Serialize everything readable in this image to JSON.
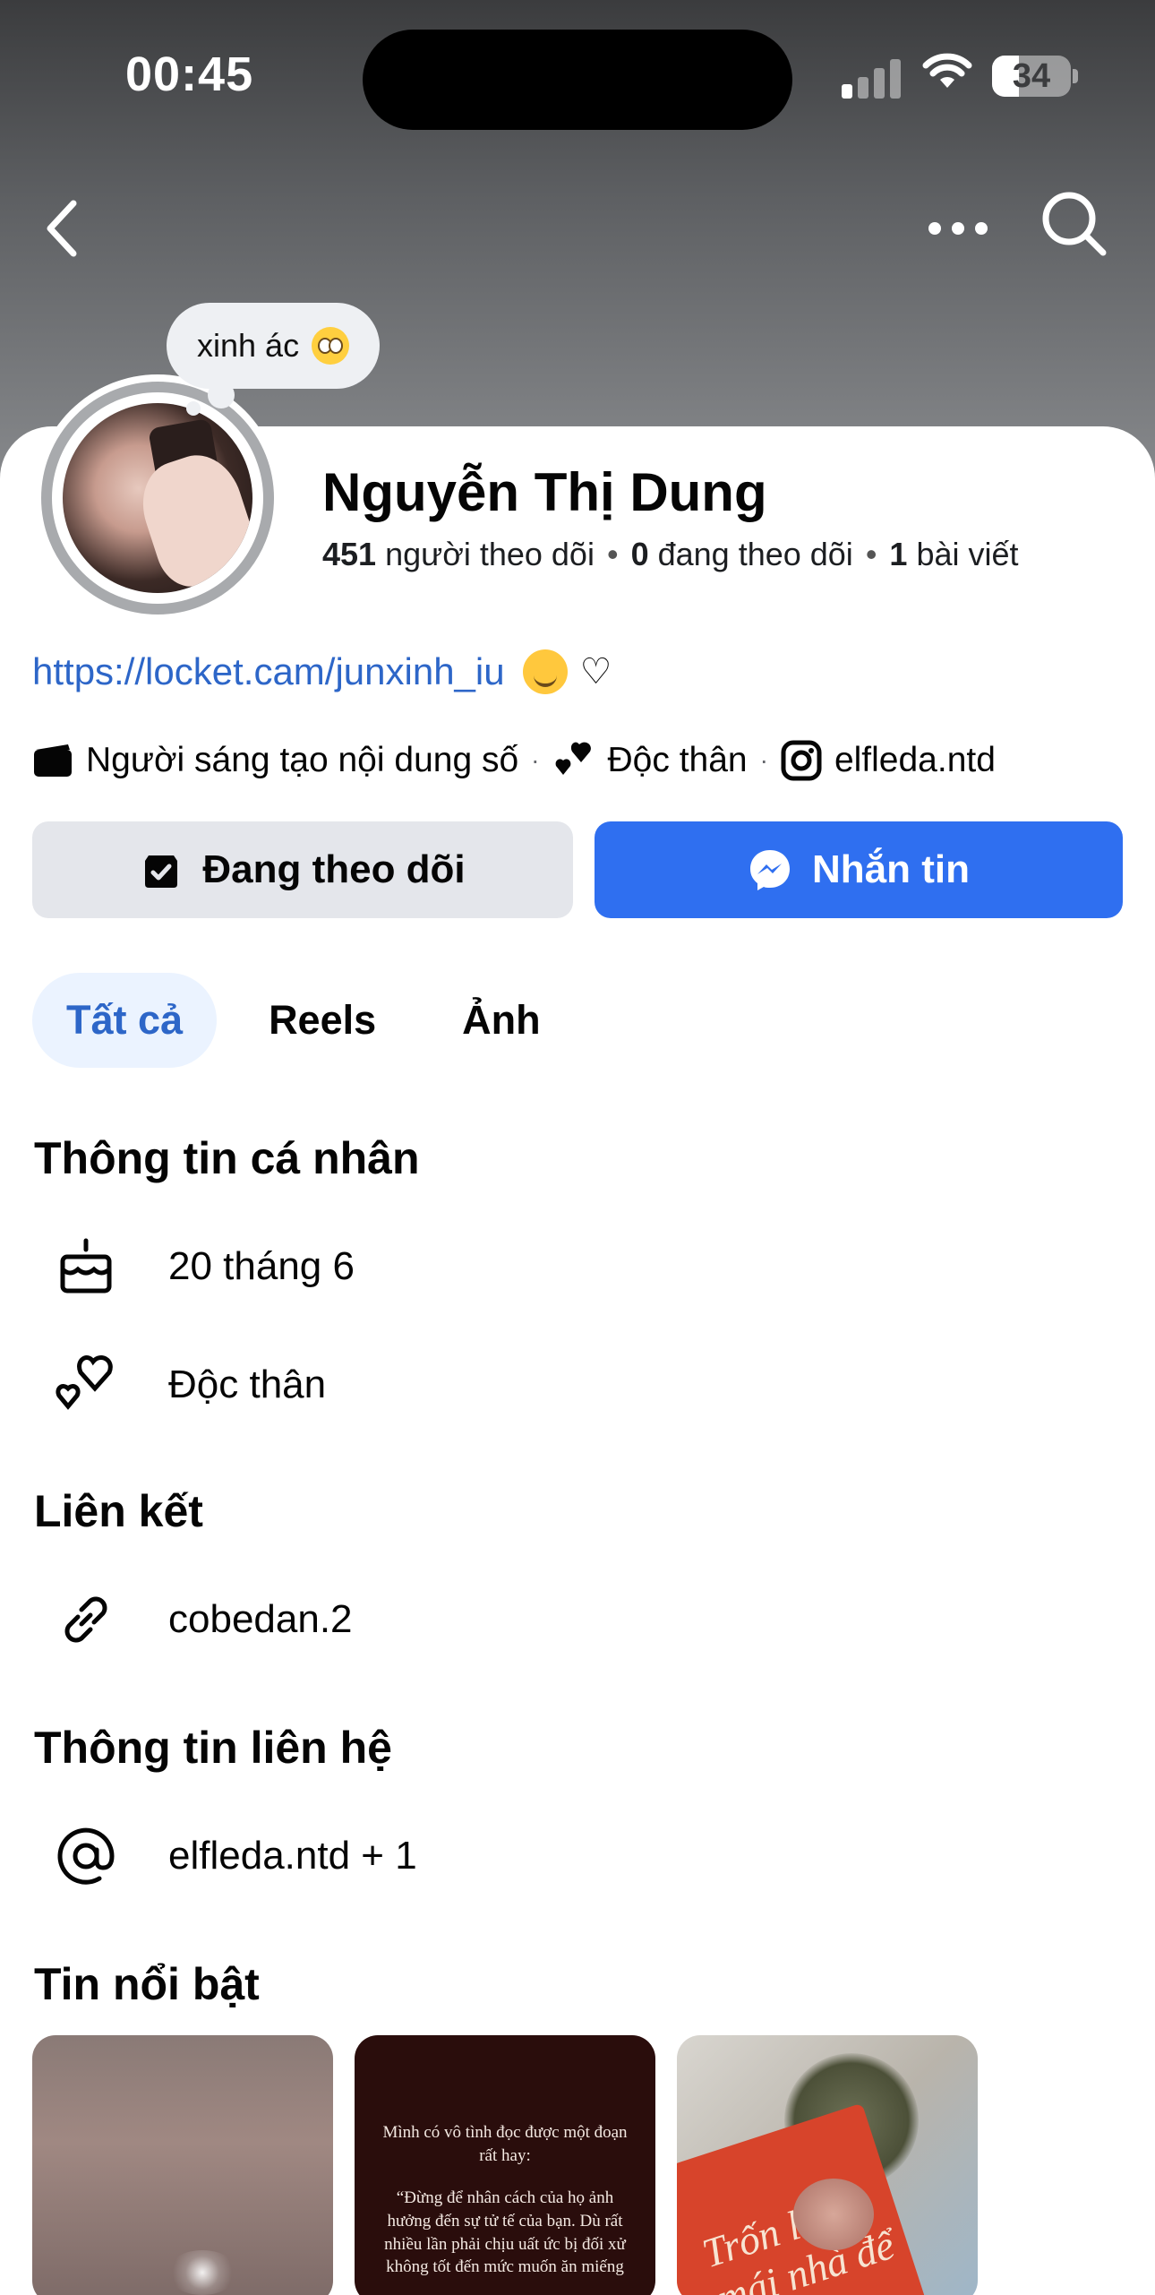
{
  "status_bar": {
    "time": "00:45",
    "battery": "34",
    "battery_level": 0.34
  },
  "note": {
    "text": "xinh ác"
  },
  "profile": {
    "name": "Nguyễn Thị Dung",
    "followers_count": "451",
    "followers_label": "người theo dõi",
    "following_count": "0",
    "following_label": "đang theo dõi",
    "posts_count": "1",
    "posts_label": "bài viết",
    "bio_link": "https://locket.cam/junxinh_iu",
    "bio_heart": "♡",
    "meta": {
      "creator": "Người sáng tạo nội dung số",
      "relationship": "Độc thân",
      "instagram": "elfleda.ntd"
    }
  },
  "actions": {
    "following_label": "Đang theo dõi",
    "message_label": "Nhắn tin"
  },
  "tabs": [
    "Tất cả",
    "Reels",
    "Ảnh"
  ],
  "sections": {
    "personal": {
      "title": "Thông tin cá nhân",
      "birthday": "20 tháng 6",
      "relationship": "Độc thân"
    },
    "links": {
      "title": "Liên kết",
      "link": "cobedan.2"
    },
    "contact": {
      "title": "Thông tin liên hệ",
      "value": "elfleda.ntd + 1"
    },
    "highlights": {
      "title": "Tin nổi bật",
      "items": [
        {
          "label": ""
        },
        {
          "line1": "Mình có vô tình đọc được một đoạn rất hay:",
          "line2": "“Đừng để nhân cách của họ ảnh hưởng đến sự tử tế của bạn. Dù rất nhiều lần phải chịu uất ức bị đối xử không tốt đến mức muốn ăn miếng"
        },
        {
          "book_title": "Trốn lên mái nhà để khóc"
        }
      ]
    }
  },
  "colors": {
    "accent": "#2f6ff0",
    "link": "#2d66c8",
    "tab_active_bg": "#ebf3ff",
    "secondary_btn": "#e4e6eb"
  }
}
